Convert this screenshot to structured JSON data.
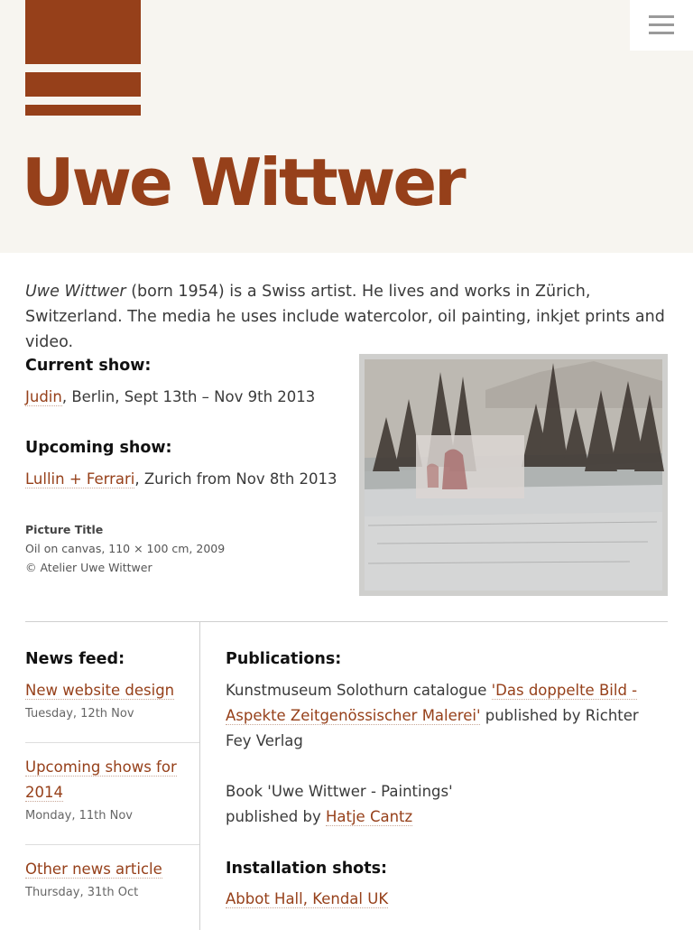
{
  "header": {
    "title": "Uwe Wittwer",
    "brand_color": "#96401a"
  },
  "intro": {
    "name": "Uwe Wittwer",
    "text": " (born 1954) is a Swiss artist. He lives and works in Zürich, Switzerland. The media he uses include watercolor, oil painting, inkjet prints and video."
  },
  "current_show": {
    "heading": "Current show:",
    "link": "Judin",
    "text": ", Berlin, Sept 13th – Nov 9th 2013"
  },
  "upcoming_show": {
    "heading": "Upcoming show:",
    "link": "Lullin + Ferrari",
    "text": ", Zurich from Nov 8th 2013"
  },
  "caption": {
    "title": "Picture Title",
    "medium": "Oil on canvas, 110 × 100 cm, 2009",
    "copyright": "© Atelier Uwe Wittwer"
  },
  "news": {
    "heading": "News feed:",
    "items": [
      {
        "title": "New website design",
        "date": "Tuesday, 12th Nov"
      },
      {
        "title": "Upcoming shows for 2014",
        "date": "Monday, 11th Nov"
      },
      {
        "title": "Other news article",
        "date": "Thursday, 31th Oct"
      }
    ]
  },
  "publications": {
    "heading": "Publications:",
    "pub1_prefix": "Kunstmuseum Solothurn catalogue ",
    "pub1_link": "'Das doppelte Bild - Aspekte Zeitgenössischer Malerei'",
    "pub1_suffix": " published by Richter Fey Verlag",
    "pub2_prefix": "Book 'Uwe Wittwer - Paintings'",
    "pub2_mid": "published by ",
    "pub2_link": "Hatje Cantz"
  },
  "installation": {
    "heading": "Installation shots:",
    "link": "Abbot Hall, Kendal UK"
  }
}
